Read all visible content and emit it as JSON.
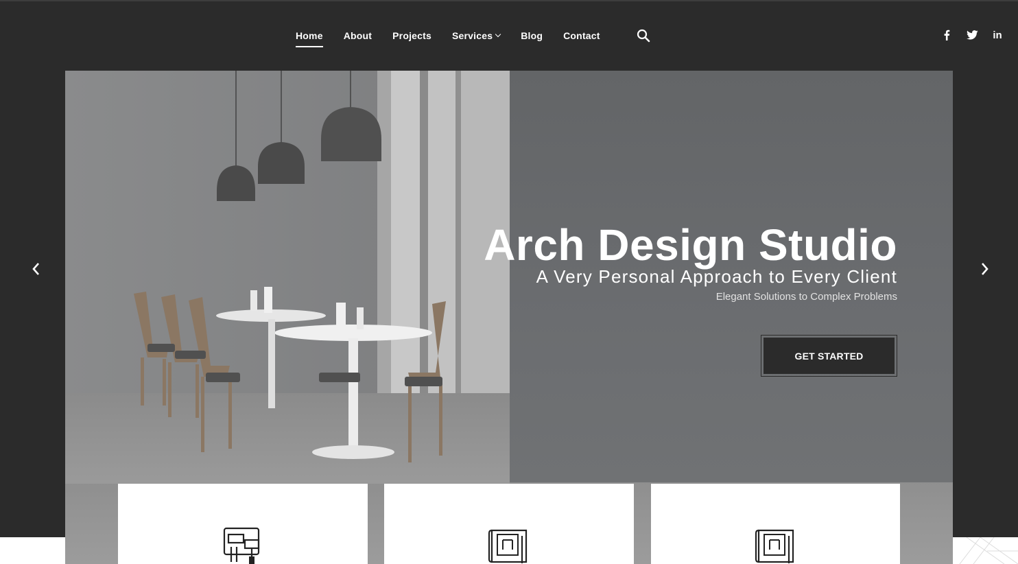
{
  "nav": {
    "items": [
      {
        "label": "Home",
        "active": true
      },
      {
        "label": "About"
      },
      {
        "label": "Projects"
      },
      {
        "label": "Services",
        "has_dropdown": true
      },
      {
        "label": "Blog"
      },
      {
        "label": "Contact"
      }
    ],
    "search_icon": "search-icon"
  },
  "social": {
    "facebook": "f",
    "twitter_icon": "twitter-icon",
    "linkedin": "in"
  },
  "hero": {
    "title": "Arch Design Studio",
    "subtitle": "A Very Personal Approach to Every Client",
    "tagline": "Elegant Solutions to Complex Problems",
    "cta_label": "GET STARTED"
  },
  "carousel": {
    "prev_icon": "chevron-left-icon",
    "next_icon": "chevron-right-icon"
  },
  "cards": [
    {
      "icon": "paint-roller-icon"
    },
    {
      "icon": "blueprint-icon"
    },
    {
      "icon": "blueprint-icon"
    }
  ],
  "colors": {
    "header_bg": "#2b2b2b",
    "text": "#ffffff",
    "cta_bg": "#2b2b2b"
  }
}
